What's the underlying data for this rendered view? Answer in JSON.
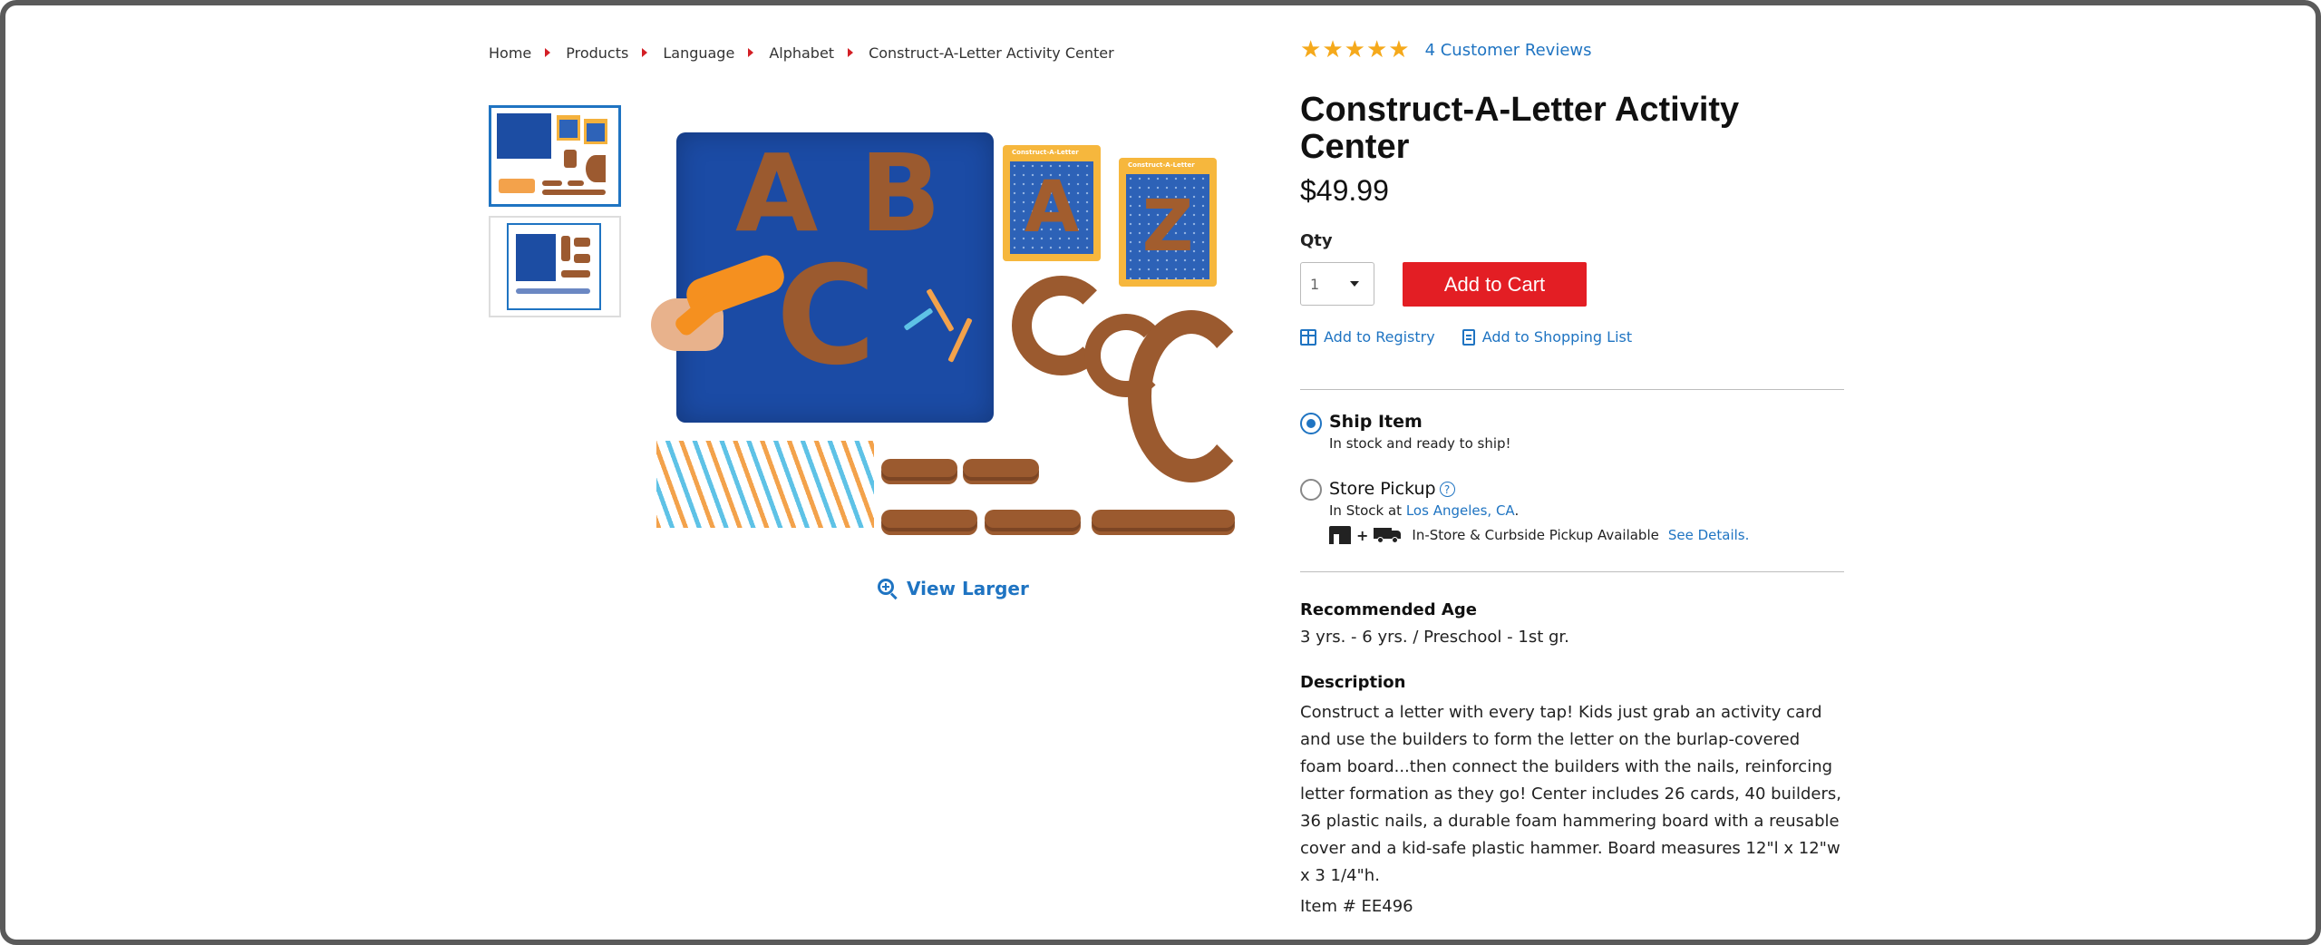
{
  "breadcrumb": [
    "Home",
    "Products",
    "Language",
    "Alphabet",
    "Construct-A-Letter Activity Center"
  ],
  "gallery": {
    "view_larger_label": "View Larger",
    "card_title": "Construct-A-Letter",
    "letters": [
      "A",
      "B",
      "C"
    ],
    "card_letters": [
      "A",
      "Z"
    ]
  },
  "product": {
    "rating_stars": 5,
    "reviews_label": "4 Customer Reviews",
    "title": "Construct-A-Letter Activity Center",
    "price": "$49.99",
    "qty_label": "Qty",
    "qty_value": "1",
    "add_to_cart_label": "Add to Cart",
    "add_to_registry_label": "Add to Registry",
    "add_to_list_label": "Add to Shopping List"
  },
  "fulfillment": {
    "ship_label": "Ship Item",
    "ship_status": "In stock and ready to ship!",
    "pickup_label": "Store Pickup",
    "pickup_status_prefix": "In Stock at",
    "pickup_location": "Los Angeles, CA",
    "pickup_suffix": ".",
    "pickup_note": "In-Store & Curbside Pickup Available",
    "see_details_label": "See Details."
  },
  "details": {
    "recommended_age_heading": "Recommended Age",
    "recommended_age": "3 yrs. - 6 yrs. / Preschool - 1st gr.",
    "description_heading": "Description",
    "description": "Construct a letter with every tap! Kids just grab an activity card and use the builders to form the letter on the burlap-covered foam board...then connect the builders with the nails, reinforcing letter formation as they go! Center includes 26 cards, 40 builders, 36 plastic nails, a durable foam hammering board with a reusable cover and a kid-safe plastic hammer. Board measures 12\"l x 12\"w x 3 1/4\"h.",
    "item_number": "Item # EE496"
  },
  "colors": {
    "accent_blue": "#1f74c2",
    "cart_red": "#e31e24",
    "star_gold": "#f5a91b",
    "breadcrumb_arrow": "#d31f26"
  }
}
